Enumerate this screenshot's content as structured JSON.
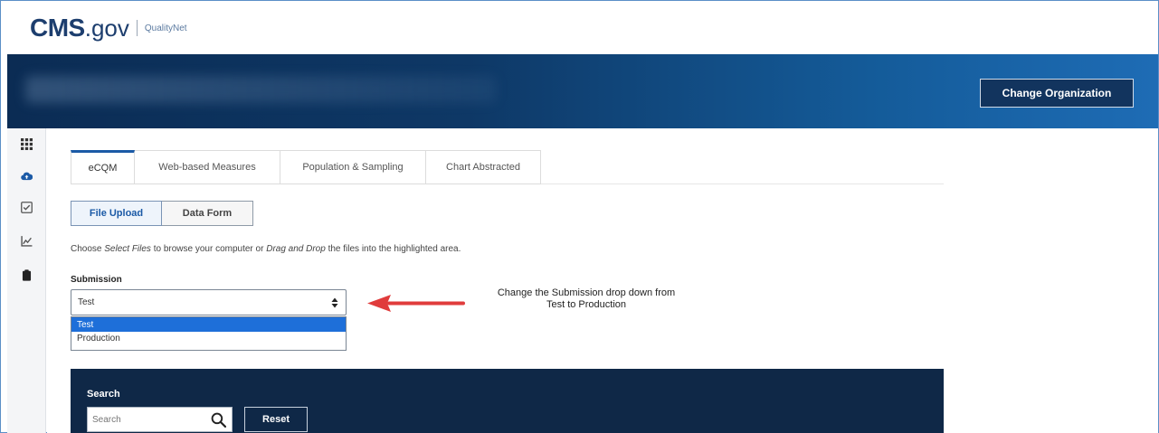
{
  "header": {
    "logo_main": "CMS",
    "logo_suffix": ".gov",
    "logo_sub": "QualityNet",
    "change_org_label": "Change Organization"
  },
  "sidebar": {
    "icons": [
      "grid-icon",
      "cloud-upload-icon",
      "checklist-icon",
      "chart-icon",
      "clipboard-icon"
    ]
  },
  "tabs": [
    {
      "label": "eCQM",
      "active": true
    },
    {
      "label": "Web-based Measures",
      "active": false
    },
    {
      "label": "Population & Sampling",
      "active": false
    },
    {
      "label": "Chart Abstracted",
      "active": false
    }
  ],
  "segmented": {
    "file_upload": "File Upload",
    "data_form": "Data Form"
  },
  "instructions": {
    "part1": "Choose ",
    "em1": "Select Files",
    "part2": " to browse your computer or ",
    "em2": "Drag and Drop",
    "part3": " the files into the highlighted area."
  },
  "submission": {
    "label": "Submission",
    "selected": "Test",
    "options": [
      "Test",
      "Production"
    ]
  },
  "annotation": {
    "line1": "Change the Submission drop down from",
    "line2": "Test to Production",
    "arrow_color": "#e03c3c"
  },
  "search": {
    "label": "Search",
    "placeholder": "Search",
    "reset_label": "Reset"
  },
  "colors": {
    "brand_navy": "#0f2847",
    "accent_blue": "#1b5aa6",
    "dropdown_highlight": "#1e6fd9"
  }
}
